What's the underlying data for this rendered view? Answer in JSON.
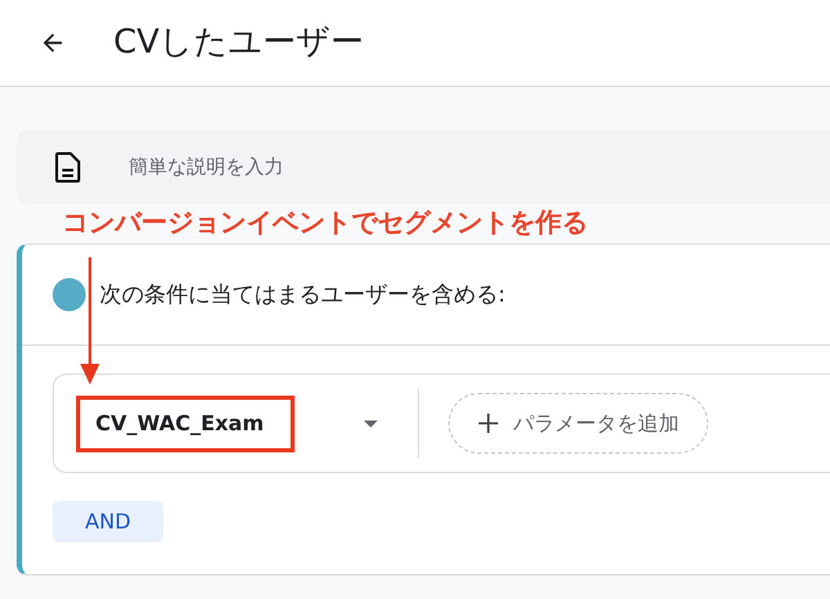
{
  "header": {
    "title": "CVしたユーザー"
  },
  "description": {
    "placeholder": "簡単な説明を入力"
  },
  "annotation": {
    "text": "コンバージョンイベントでセグメントを作る"
  },
  "condition_group": {
    "heading": "次の条件に当てはまるユーザーを含める:",
    "event": {
      "value": "CV_WAC_Exam",
      "highlighted": true
    },
    "add_parameter": "パラメータを追加",
    "and_button": "AND"
  }
}
